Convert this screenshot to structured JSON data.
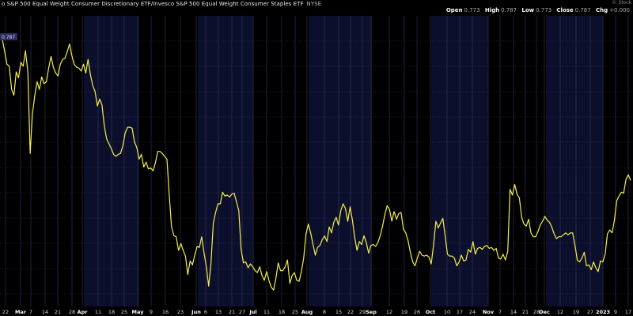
{
  "header": {
    "title": "o S&P 500 Equal Weight Consumer Discretionary ETF/Invesco S&P 500 Equal Weight Consumer Staples ETF",
    "exchange": "NYSE",
    "open_label": "Open",
    "open_value": "0.773",
    "high_label": "High",
    "high_value": "0.787",
    "low_label": "Low",
    "low_value": "0.773",
    "close_label": "Close",
    "close_value": "0.787",
    "chg_label": "Chg",
    "chg_value": "+0.000",
    "watermark": "© Stock"
  },
  "colors": {
    "background": "#000000",
    "band": "#0c0f2c",
    "grid": "#34375c",
    "line": "#f4ef4a",
    "label_box": "#2b2b66"
  },
  "chart_data": {
    "type": "line",
    "last_value_label": "0.787",
    "series": [
      {
        "values": [
          0.906,
          0.906,
          0.893,
          0.88,
          0.878,
          0.854,
          0.848,
          0.872,
          0.866,
          0.882,
          0.878,
          0.894,
          0.872,
          0.788,
          0.829,
          0.848,
          0.862,
          0.854,
          0.867,
          0.86,
          0.862,
          0.876,
          0.888,
          0.877,
          0.871,
          0.868,
          0.88,
          0.885,
          0.886,
          0.893,
          0.901,
          0.889,
          0.88,
          0.877,
          0.876,
          0.873,
          0.88,
          0.871,
          0.885,
          0.869,
          0.858,
          0.852,
          0.837,
          0.844,
          0.838,
          0.816,
          0.803,
          0.798,
          0.793,
          0.787,
          0.785,
          0.787,
          0.788,
          0.796,
          0.809,
          0.815,
          0.815,
          0.814,
          0.8,
          0.794,
          0.782,
          0.787,
          0.774,
          0.779,
          0.772,
          0.773,
          0.77,
          0.778,
          0.79,
          0.79,
          0.788,
          0.785,
          0.782,
          0.745,
          0.712,
          0.703,
          0.702,
          0.688,
          0.695,
          0.688,
          0.682,
          0.663,
          0.677,
          0.673,
          0.683,
          0.692,
          0.691,
          0.702,
          0.685,
          0.671,
          0.651,
          0.674,
          0.716,
          0.727,
          0.736,
          0.736,
          0.748,
          0.744,
          0.745,
          0.743,
          0.746,
          0.747,
          0.738,
          0.729,
          0.689,
          0.675,
          0.676,
          0.67,
          0.674,
          0.671,
          0.667,
          0.665,
          0.671,
          0.662,
          0.657,
          0.666,
          0.657,
          0.65,
          0.647,
          0.659,
          0.675,
          0.667,
          0.667,
          0.671,
          0.678,
          0.654,
          0.662,
          0.665,
          0.657,
          0.656,
          0.666,
          0.68,
          0.705,
          0.715,
          0.706,
          0.694,
          0.683,
          0.691,
          0.693,
          0.699,
          0.703,
          0.697,
          0.712,
          0.706,
          0.717,
          0.722,
          0.714,
          0.729,
          0.736,
          0.731,
          0.718,
          0.733,
          0.719,
          0.701,
          0.688,
          0.697,
          0.694,
          0.703,
          0.696,
          0.685,
          0.693,
          0.694,
          0.692,
          0.696,
          0.703,
          0.713,
          0.725,
          0.734,
          0.73,
          0.718,
          0.728,
          0.72,
          0.726,
          0.727,
          0.71,
          0.706,
          0.698,
          0.686,
          0.676,
          0.672,
          0.68,
          0.687,
          0.683,
          0.682,
          0.683,
          0.681,
          0.674,
          0.693,
          0.718,
          0.711,
          0.716,
          0.721,
          0.703,
          0.684,
          0.682,
          0.682,
          0.68,
          0.672,
          0.676,
          0.683,
          0.677,
          0.678,
          0.689,
          0.686,
          0.697,
          0.684,
          0.69,
          0.691,
          0.689,
          0.692,
          0.693,
          0.69,
          0.691,
          0.688,
          0.69,
          0.68,
          0.679,
          0.684,
          0.678,
          0.687,
          0.751,
          0.745,
          0.756,
          0.746,
          0.742,
          0.722,
          0.715,
          0.713,
          0.72,
          0.706,
          0.702,
          0.702,
          0.707,
          0.714,
          0.718,
          0.723,
          0.719,
          0.717,
          0.712,
          0.705,
          0.7,
          0.702,
          0.702,
          0.704,
          0.706,
          0.704,
          0.706,
          0.706,
          0.693,
          0.678,
          0.676,
          0.68,
          0.686,
          0.672,
          0.673,
          0.668,
          0.676,
          0.67,
          0.666,
          0.677,
          0.676,
          0.684,
          0.705,
          0.709,
          0.706,
          0.719,
          0.739,
          0.744,
          0.748,
          0.747,
          0.761,
          0.766,
          0.76
        ]
      }
    ],
    "x_ticks": [
      {
        "label": "22",
        "major": false
      },
      {
        "label": "Mar",
        "major": true
      },
      {
        "label": "7",
        "major": false
      },
      {
        "label": "14",
        "major": false
      },
      {
        "label": "21",
        "major": false
      },
      {
        "label": "28",
        "major": false
      },
      {
        "label": "Apr",
        "major": true
      },
      {
        "label": "11",
        "major": false
      },
      {
        "label": "18",
        "major": false
      },
      {
        "label": "25",
        "major": false
      },
      {
        "label": "May",
        "major": true
      },
      {
        "label": "9",
        "major": false
      },
      {
        "label": "16",
        "major": false
      },
      {
        "label": "23",
        "major": false
      },
      {
        "label": "Jun",
        "major": true
      },
      {
        "label": "6",
        "major": false
      },
      {
        "label": "13",
        "major": false
      },
      {
        "label": "21",
        "major": false
      },
      {
        "label": "27",
        "major": false
      },
      {
        "label": "Jul",
        "major": true
      },
      {
        "label": "11",
        "major": false
      },
      {
        "label": "18",
        "major": false
      },
      {
        "label": "25",
        "major": false
      },
      {
        "label": "Aug",
        "major": true
      },
      {
        "label": "8",
        "major": false
      },
      {
        "label": "15",
        "major": false
      },
      {
        "label": "22",
        "major": false
      },
      {
        "label": "29",
        "major": false
      },
      {
        "label": "Sep",
        "major": true
      },
      {
        "label": "12",
        "major": false
      },
      {
        "label": "19",
        "major": false
      },
      {
        "label": "26",
        "major": false
      },
      {
        "label": "Oct",
        "major": true
      },
      {
        "label": "10",
        "major": false
      },
      {
        "label": "17",
        "major": false
      },
      {
        "label": "24",
        "major": false
      },
      {
        "label": "Nov",
        "major": true
      },
      {
        "label": "7",
        "major": false
      },
      {
        "label": "14",
        "major": false
      },
      {
        "label": "21",
        "major": false
      },
      {
        "label": "28",
        "major": false
      },
      {
        "label": "Dec",
        "major": true
      },
      {
        "label": "12",
        "major": false
      },
      {
        "label": "19",
        "major": false
      },
      {
        "label": "27",
        "major": false
      },
      {
        "label": "2023",
        "major": true
      },
      {
        "label": "9",
        "major": false
      },
      {
        "label": "17",
        "major": false
      }
    ],
    "grid": true,
    "ylim": [
      0.63,
      0.93
    ]
  }
}
